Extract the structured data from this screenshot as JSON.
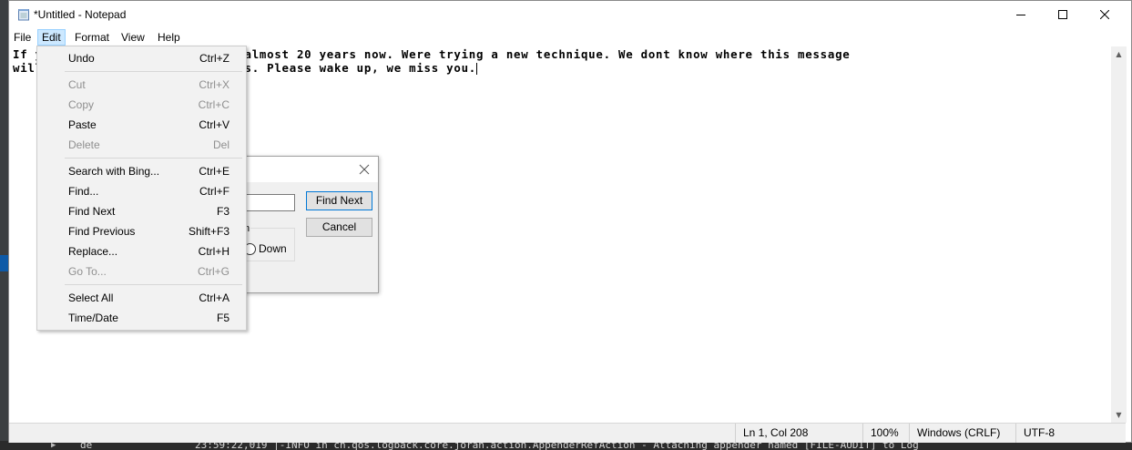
{
  "window": {
    "title": "*Untitled - Notepad"
  },
  "menubar": {
    "items": [
      "File",
      "Edit",
      "Format",
      "View",
      "Help"
    ]
  },
  "editor": {
    "line1": "If you have been in a coma for almost 20 years now. Were trying a new technique. We dont know where this message",
    "line2": "will end up but we hope it works. Please wake up, we miss you."
  },
  "edit_menu": {
    "items": [
      {
        "label": "Undo",
        "shortcut": "Ctrl+Z",
        "enabled": true
      },
      {
        "label": "Cut",
        "shortcut": "Ctrl+X",
        "enabled": false
      },
      {
        "label": "Copy",
        "shortcut": "Ctrl+C",
        "enabled": false
      },
      {
        "label": "Paste",
        "shortcut": "Ctrl+V",
        "enabled": true
      },
      {
        "label": "Delete",
        "shortcut": "Del",
        "enabled": false
      },
      {
        "label": "Search with Bing...",
        "shortcut": "Ctrl+E",
        "enabled": true
      },
      {
        "label": "Find...",
        "shortcut": "Ctrl+F",
        "enabled": true
      },
      {
        "label": "Find Next",
        "shortcut": "F3",
        "enabled": true
      },
      {
        "label": "Find Previous",
        "shortcut": "Shift+F3",
        "enabled": true
      },
      {
        "label": "Replace...",
        "shortcut": "Ctrl+H",
        "enabled": true
      },
      {
        "label": "Go To...",
        "shortcut": "Ctrl+G",
        "enabled": false
      },
      {
        "label": "Select All",
        "shortcut": "Ctrl+A",
        "enabled": true
      },
      {
        "label": "Time/Date",
        "shortcut": "F5",
        "enabled": true
      }
    ]
  },
  "find_dialog": {
    "find_next_label": "Find Next",
    "cancel_label": "Cancel",
    "direction_label_partial": "n",
    "down_label": "Down"
  },
  "statusbar": {
    "position": "Ln 1, Col 208",
    "zoom": "100%",
    "line_ending": "Windows (CRLF)",
    "encoding": "UTF-8"
  },
  "background": {
    "console_text": "23:59:22,019 |-INFO in ch.qos.logback.core.joran.action.AppenderRefAction - Attaching appender named [FILE-AUDIT] to Log",
    "tree_label": "de"
  },
  "colors": {
    "menu_highlight": "#cce8ff",
    "dialog_bg": "#f0f0f0",
    "disabled_text": "#8f8f8f"
  }
}
